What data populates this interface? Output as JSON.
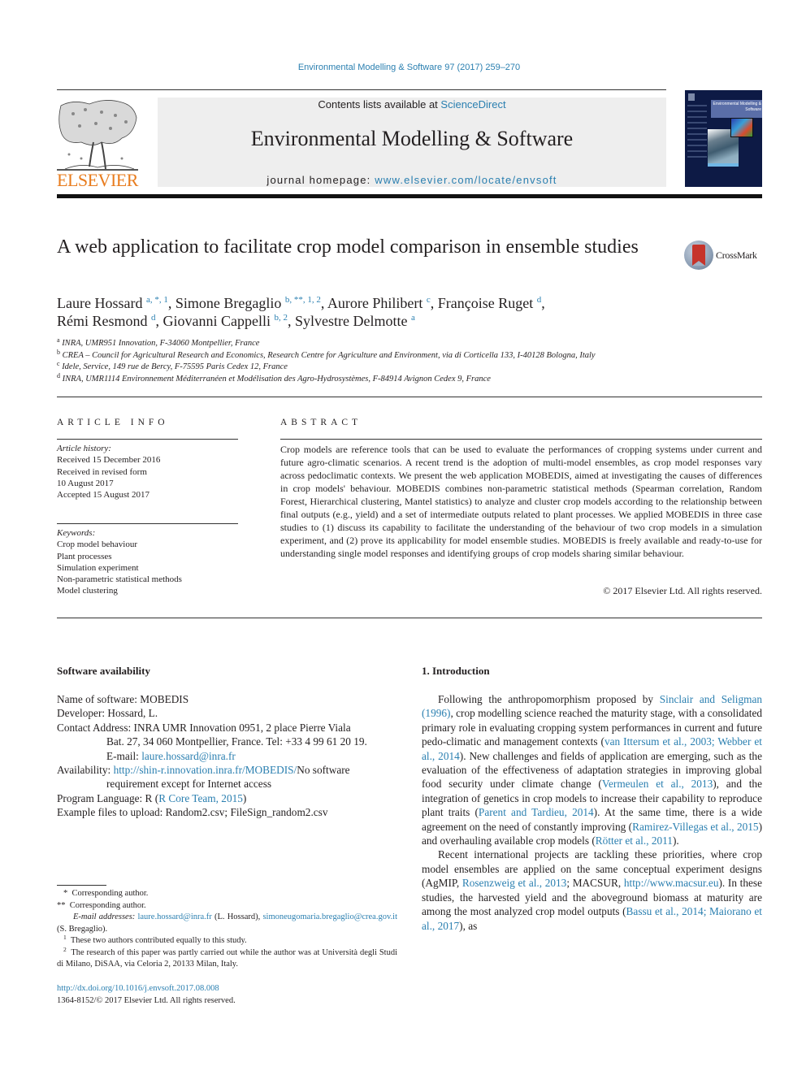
{
  "citation": "Environmental Modelling & Software 97 (2017) 259–270",
  "header": {
    "publisher_logo_text": "ELSEVIER",
    "contents_prefix": "Contents lists available at ",
    "contents_link": "ScienceDirect",
    "journal_title": "Environmental Modelling & Software",
    "homepage_prefix": "journal homepage: ",
    "homepage_link": "www.elsevier.com/locate/envsoft",
    "cover_title": "Environmental Modelling & Software",
    "crossmark_label": "CrossMark"
  },
  "article": {
    "title": "A web application to facilitate crop model comparison in ensemble studies",
    "authors": [
      {
        "name": "Laure Hossard",
        "marks": "a, *, 1",
        "sep": ", "
      },
      {
        "name": "Simone Bregaglio",
        "marks": "b, **, 1, 2",
        "sep": ", "
      },
      {
        "name": "Aurore Philibert",
        "marks": "c",
        "sep": ", "
      },
      {
        "name": "Françoise Ruget",
        "marks": "d",
        "sep": ","
      },
      {
        "name": "Rémi Resmond",
        "marks": "d",
        "sep": ", "
      },
      {
        "name": "Giovanni Cappelli",
        "marks": "b, 2",
        "sep": ", "
      },
      {
        "name": "Sylvestre Delmotte",
        "marks": "a",
        "sep": ""
      }
    ],
    "affiliations": [
      {
        "key": "a",
        "text": "INRA, UMR951 Innovation, F-34060 Montpellier, France"
      },
      {
        "key": "b",
        "text": "CREA – Council for Agricultural Research and Economics, Research Centre for Agriculture and Environment, via di Corticella 133, I-40128 Bologna, Italy"
      },
      {
        "key": "c",
        "text": "Idele, Service, 149 rue de Bercy, F-75595 Paris Cedex 12, France"
      },
      {
        "key": "d",
        "text": "INRA, UMR1114 Environnement Méditerranéen et Modélisation des Agro-Hydrosystèmes, F-84914 Avignon Cedex 9, France"
      }
    ]
  },
  "article_info": {
    "heading": "ARTICLE INFO",
    "history_label": "Article history:",
    "history": [
      "Received 15 December 2016",
      "Received in revised form",
      "10 August 2017",
      "Accepted 15 August 2017"
    ],
    "keywords_label": "Keywords:",
    "keywords": [
      "Crop model behaviour",
      "Plant processes",
      "Simulation experiment",
      "Non-parametric statistical methods",
      "Model clustering"
    ]
  },
  "abstract": {
    "heading": "ABSTRACT",
    "text": "Crop models are reference tools that can be used to evaluate the performances of cropping systems under current and future agro-climatic scenarios. A recent trend is the adoption of multi-model en­sembles, as crop model responses vary across pedoclimatic contexts. We present the web application MOBEDIS, aimed at investigating the causes of differences in crop models' behaviour. MOBEDIS combines non-parametric statistical methods (Spearman correlation, Random Forest, Hierarchical clustering, Mantel statistics) to analyze and cluster crop models according to the relationship between final outputs (e.g., yield) and a set of intermediate outputs related to plant processes. We applied MOBEDIS in three case studies to (1) discuss its capability to facilitate the understanding of the behaviour of two crop models in a simulation experiment, and (2) prove its applicability for model ensemble studies. MOBEDIS is freely available and ready-to-use for understanding single model responses and identifying groups of crop models sharing similar behaviour.",
    "copyright": "© 2017 Elsevier Ltd. All rights reserved."
  },
  "software": {
    "heading": "Software availability",
    "name_line": "Name of software: MOBEDIS",
    "developer_line": "Developer: Hossard, L.",
    "contact_line1": "Contact Address: INRA UMR Innovation 0951, 2 place Pierre Viala",
    "contact_line2": "Bat. 27, 34 060 Montpellier, France. Tel: +33 4 99 61 20 19.",
    "email_prefix": "E-mail: ",
    "email": "laure.hossard@inra.fr",
    "availability_prefix": "Availability: ",
    "availability_link": "http://shin-r.innovation.inra.fr/MOBEDIS/",
    "availability_suffix": "No software",
    "availability_line2": "requirement except for Internet access",
    "language_prefix": "Program Language: R (",
    "language_link": "R Core Team, 2015",
    "language_suffix": ")",
    "examples_line": "Example files to upload: Random2.csv; FileSign_random2.csv"
  },
  "introduction": {
    "heading": "1.  Introduction",
    "p1": [
      {
        "t": "Following the anthropomorphism proposed by "
      },
      {
        "t": "Sinclair and Seligman (1996)",
        "link": true
      },
      {
        "t": ", crop modelling science reached the maturity stage, with a consolidated primary role in evaluating cropping system performances in current and future pedo-climatic and management contexts ("
      },
      {
        "t": "van Ittersum et al., 2003; Webber et al., 2014",
        "link": true
      },
      {
        "t": "). New challenges and fields of application are emerging, such as the evaluation of the effectiveness of adaptation strategies in improving global food security under climate change ("
      },
      {
        "t": "Vermeulen et al., 2013",
        "link": true
      },
      {
        "t": "), and the integration of genetics in crop models to increase their capability to reproduce plant traits ("
      },
      {
        "t": "Parent and Tardieu, 2014",
        "link": true
      },
      {
        "t": "). At the same time, there is a wide agreement on the need of constantly improving ("
      },
      {
        "t": "Ramirez-Villegas et al., 2015",
        "link": true
      },
      {
        "t": ") and overhauling available crop models ("
      },
      {
        "t": "Rötter et al., 2011",
        "link": true
      },
      {
        "t": ")."
      }
    ],
    "p2": [
      {
        "t": "Recent international projects are tackling these priorities, where crop model ensembles are applied on the same conceptual exper­iment designs (AgMIP, "
      },
      {
        "t": "Rosenzweig et al., 2013",
        "link": true
      },
      {
        "t": "; MACSUR, "
      },
      {
        "t": "http://www.macsur.eu",
        "link": true
      },
      {
        "t": "). In these studies, the harvested yield and the aboveground biomass at maturity are among the most analyzed crop model outputs ("
      },
      {
        "t": "Bassu et al., 2014; Maiorano et al., 2017",
        "link": true
      },
      {
        "t": "), as"
      }
    ]
  },
  "footnotes": {
    "star1": "*  Corresponding author.",
    "star2": "**  Corresponding author.",
    "email_label": "E-mail addresses: ",
    "email1": "laure.hossard@inra.fr",
    "email1_owner": " (L. Hossard), ",
    "email2": "simoneugomaria.bregaglio@crea.gov.it",
    "email2_owner": " (S. Bregaglio).",
    "fn1": "These two authors contributed equally to this study.",
    "fn2": "The research of this paper was partly carried out while the author was at Università degli Studi di Milano, DiSAA, via Celoria 2, 20133 Milan, Italy.",
    "doi": "http://dx.doi.org/10.1016/j.envsoft.2017.08.008",
    "issn": "1364-8152/© 2017 Elsevier Ltd. All rights reserved."
  }
}
